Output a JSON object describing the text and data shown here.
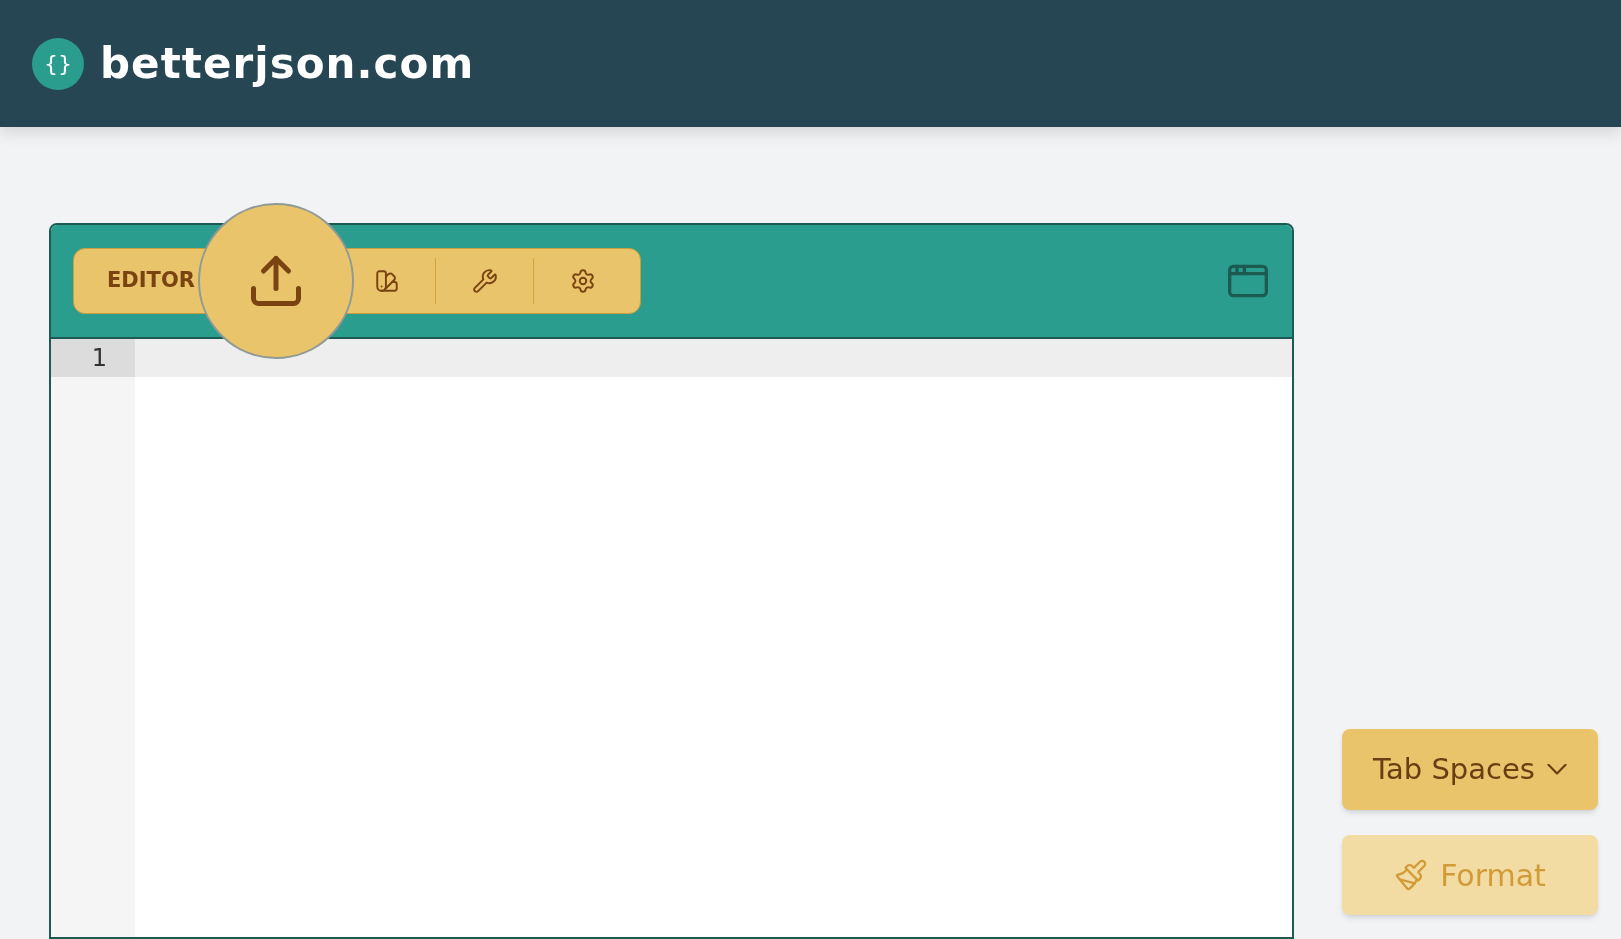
{
  "header": {
    "logo_text": "betterjson.com",
    "logo_icon_text": "{}"
  },
  "toolbar": {
    "label": "EDITOR",
    "tools": [
      {
        "kind": "upload",
        "highlighted": true
      },
      {
        "kind": "theme",
        "highlighted": false
      },
      {
        "kind": "tools",
        "highlighted": false
      },
      {
        "kind": "settings",
        "highlighted": false
      }
    ]
  },
  "editor": {
    "lines": [
      {
        "number": "1",
        "active": true
      }
    ]
  },
  "side": {
    "tab_spaces": {
      "label": "Tab Spaces"
    },
    "format": {
      "label": "Format",
      "disabled": true
    }
  }
}
